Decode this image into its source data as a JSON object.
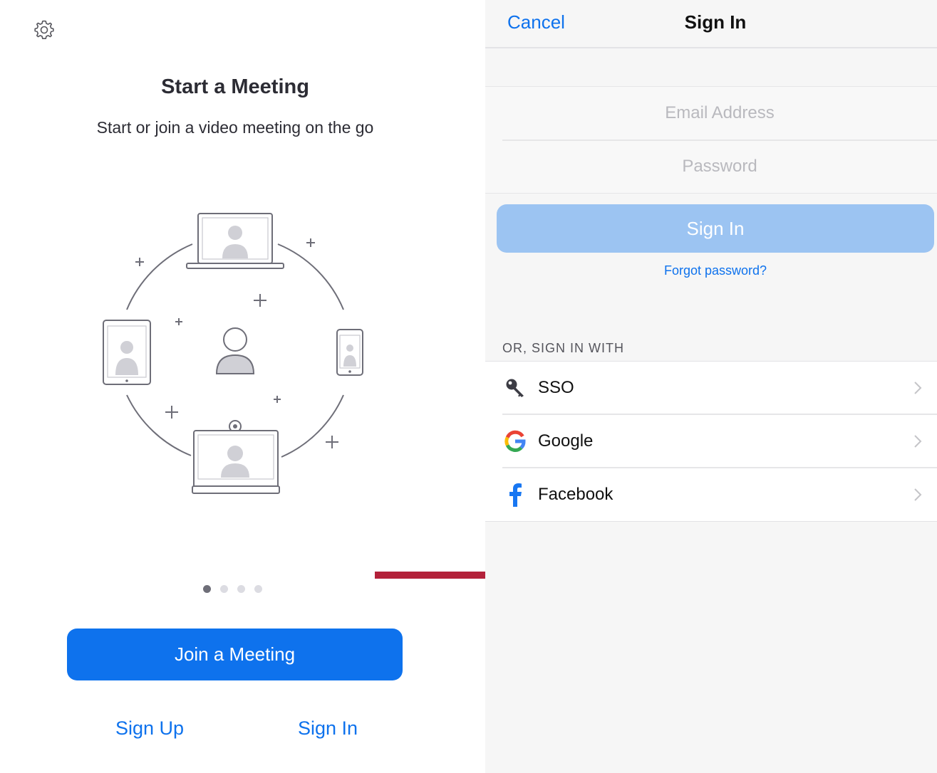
{
  "left_screen": {
    "title": "Start a Meeting",
    "subtitle": "Start or join a video meeting on the go",
    "join_button": "Join a Meeting",
    "sign_up_link": "Sign Up",
    "sign_in_link": "Sign In",
    "page_dots": {
      "count": 4,
      "active_index": 0
    }
  },
  "right_screen": {
    "nav": {
      "cancel": "Cancel",
      "title": "Sign In"
    },
    "email_placeholder": "Email Address",
    "password_placeholder": "Password",
    "sign_in_button": "Sign In",
    "forgot_password": "Forgot password?",
    "or_label": "OR, SIGN IN WITH",
    "providers": [
      {
        "label": "SSO",
        "icon": "key-icon"
      },
      {
        "label": "Google",
        "icon": "google-icon"
      },
      {
        "label": "Facebook",
        "icon": "facebook-icon"
      }
    ]
  },
  "colors": {
    "accent": "#0e72ed",
    "disabled_button": "#9cc4f2",
    "arrow": "#b3213a"
  }
}
